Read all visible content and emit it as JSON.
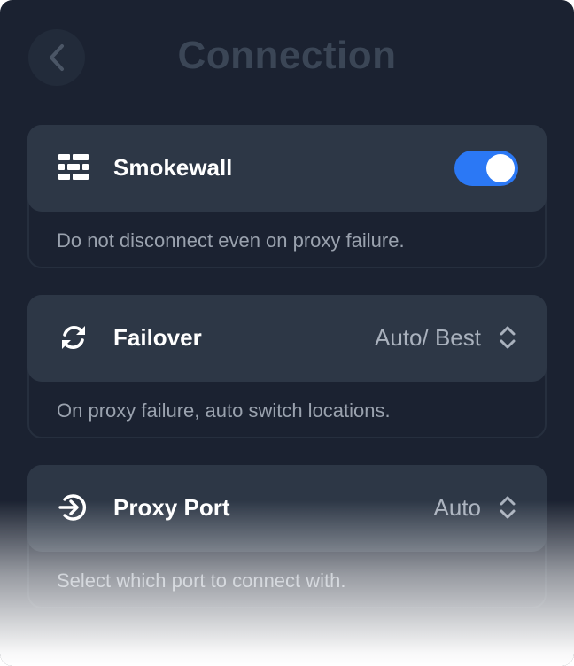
{
  "header": {
    "title": "Connection",
    "back_icon": "chevron-left-icon"
  },
  "colors": {
    "background": "#1b2231",
    "card_top": "#2d3746",
    "accent": "#2b78f5",
    "title": "#3b4656"
  },
  "settings": [
    {
      "icon": "firewall-icon",
      "label": "Smokewall",
      "control": "toggle",
      "enabled": true,
      "description": "Do not disconnect even on proxy failure."
    },
    {
      "icon": "refresh-icon",
      "label": "Failover",
      "control": "select",
      "value": "Auto/ Best",
      "description": "On proxy failure, auto switch locations."
    },
    {
      "icon": "sign-in-icon",
      "label": "Proxy Port",
      "control": "select",
      "value": "Auto",
      "description": "Select which port to connect with."
    }
  ]
}
